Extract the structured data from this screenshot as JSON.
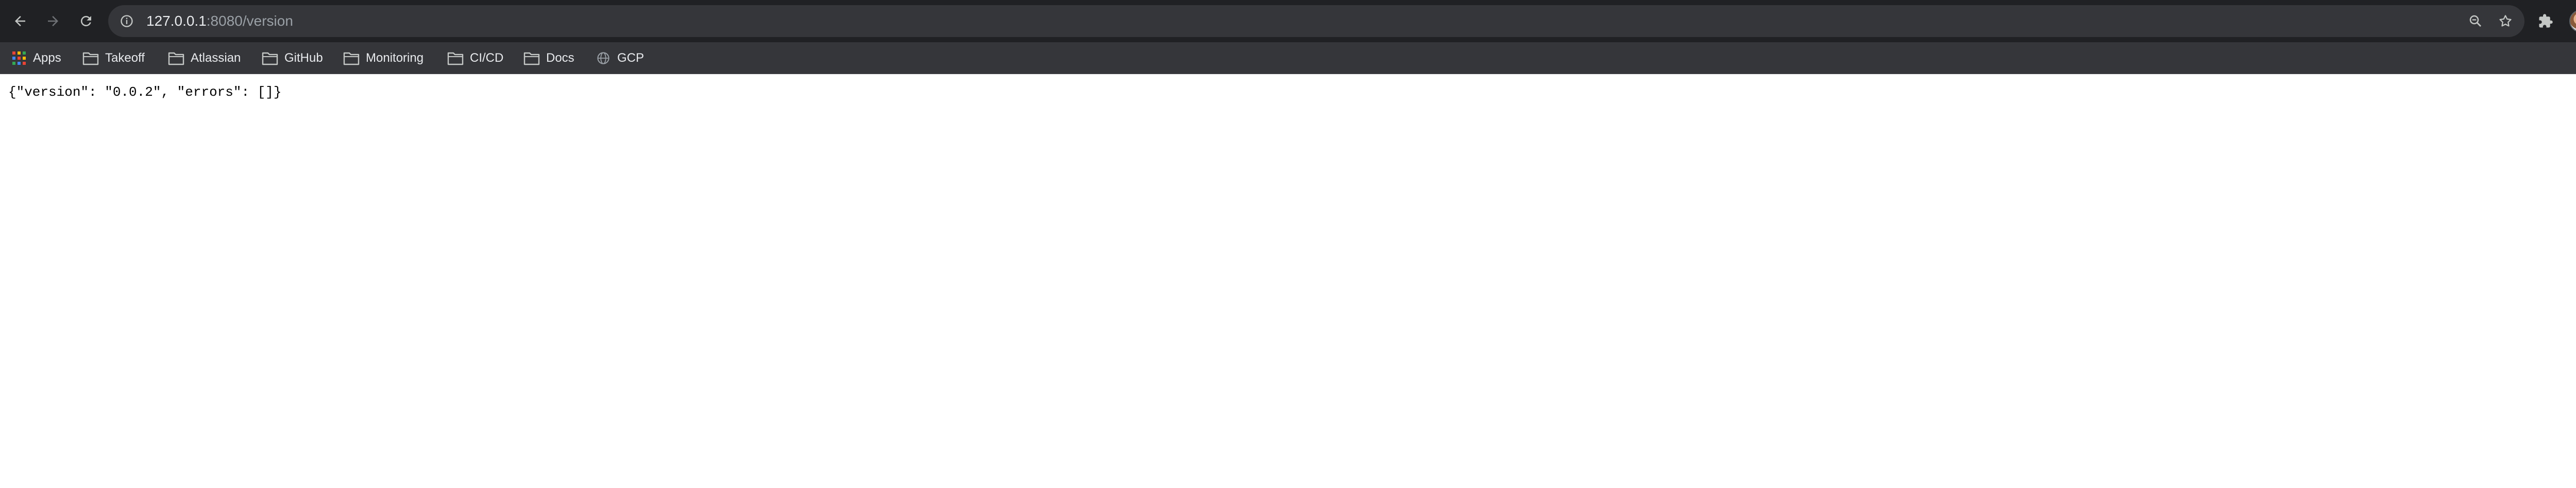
{
  "browser": {
    "url_host": "127.0.0.1",
    "url_rest": ":8080/version",
    "back_label": "Back",
    "forward_label": "Forward",
    "reload_label": "Reload"
  },
  "bookmarks": [
    {
      "label": "Apps",
      "icon": "apps-grid-icon"
    },
    {
      "label": "Takeoff",
      "icon": "folder-icon"
    },
    {
      "label": "Atlassian",
      "icon": "folder-icon"
    },
    {
      "label": "GitHub",
      "icon": "folder-icon"
    },
    {
      "label": "Monitoring",
      "icon": "folder-icon"
    },
    {
      "label": "CI/CD",
      "icon": "folder-icon"
    },
    {
      "label": "Docs",
      "icon": "folder-icon"
    },
    {
      "label": "GCP",
      "icon": "globe-icon"
    }
  ],
  "page": {
    "body_text": "{\"version\": \"0.0.2\", \"errors\": []}"
  },
  "colors": {
    "toolbar_bg": "#202124",
    "omnibox_bg": "#35363a",
    "bookmark_bar_bg": "#35363a",
    "icon_color": "#c4c7c5",
    "apps_grid_colors": [
      "#ea4335",
      "#fbbc05",
      "#34a853",
      "#4285f4"
    ]
  }
}
